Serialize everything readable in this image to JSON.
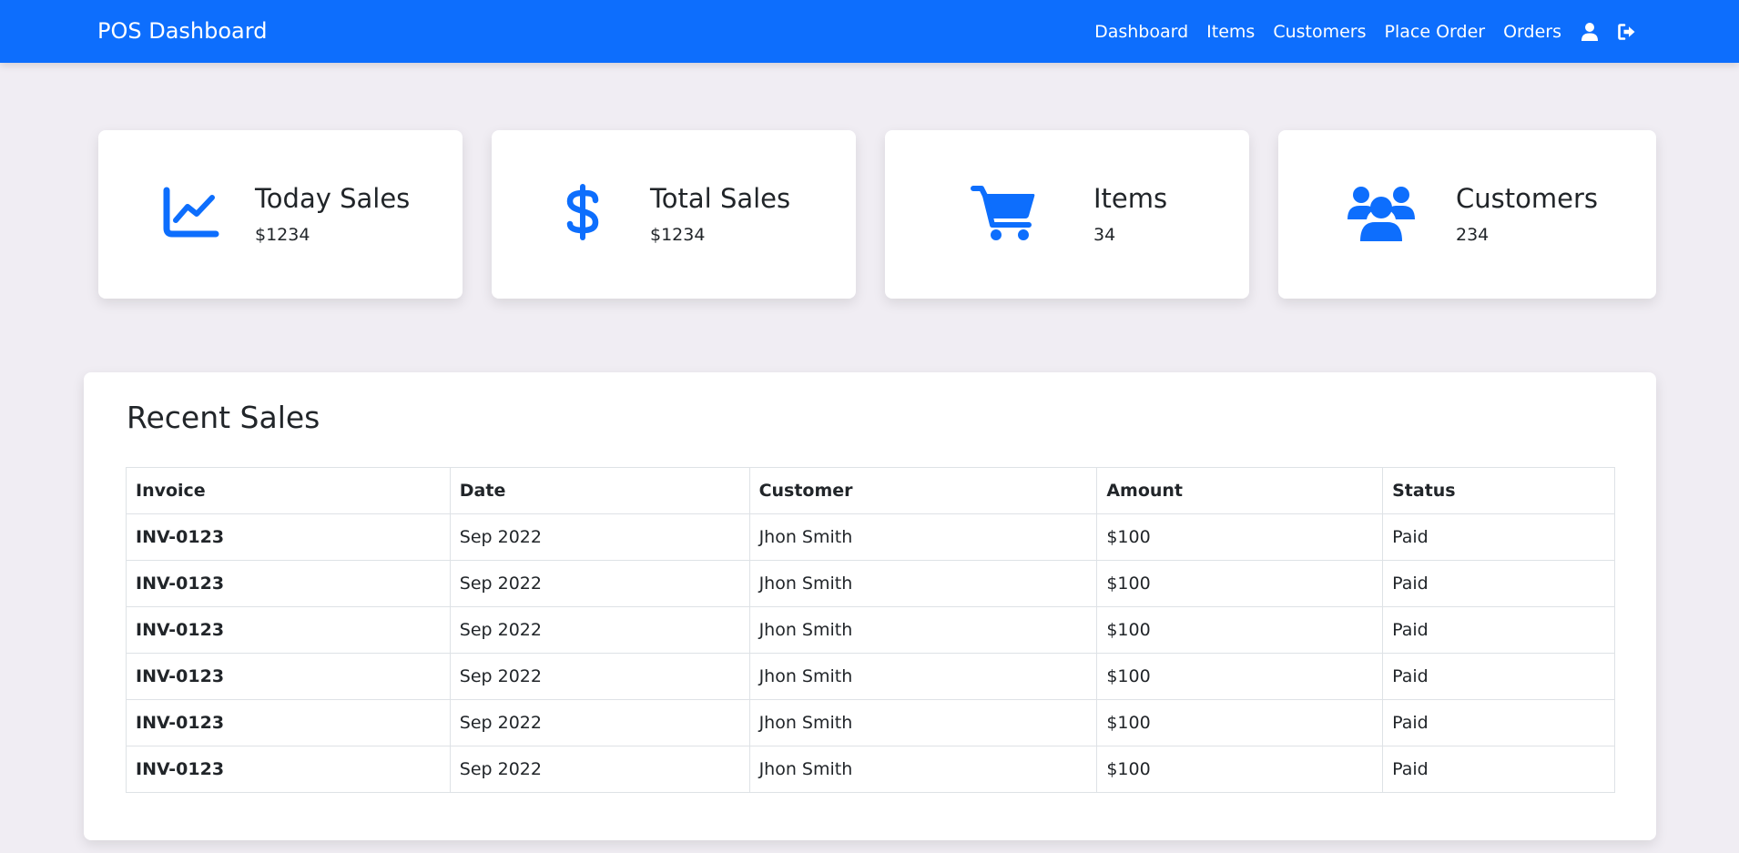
{
  "navbar": {
    "brand": "POS Dashboard",
    "links": [
      {
        "label": "Dashboard"
      },
      {
        "label": "Items"
      },
      {
        "label": "Customers"
      },
      {
        "label": "Place Order"
      },
      {
        "label": "Orders"
      }
    ],
    "icons": [
      "user-icon",
      "logout-icon"
    ]
  },
  "stats": [
    {
      "icon": "chart-line-icon",
      "title": "Today Sales",
      "value": "$1234"
    },
    {
      "icon": "dollar-icon",
      "title": "Total Sales",
      "value": "$1234"
    },
    {
      "icon": "cart-icon",
      "title": "Items",
      "value": "34"
    },
    {
      "icon": "users-icon",
      "title": "Customers",
      "value": "234"
    }
  ],
  "recent_sales": {
    "title": "Recent Sales",
    "columns": [
      "Invoice",
      "Date",
      "Customer",
      "Amount",
      "Status"
    ],
    "rows": [
      [
        "INV-0123",
        "Sep 2022",
        "Jhon Smith",
        "$100",
        "Paid"
      ],
      [
        "INV-0123",
        "Sep 2022",
        "Jhon Smith",
        "$100",
        "Paid"
      ],
      [
        "INV-0123",
        "Sep 2022",
        "Jhon Smith",
        "$100",
        "Paid"
      ],
      [
        "INV-0123",
        "Sep 2022",
        "Jhon Smith",
        "$100",
        "Paid"
      ],
      [
        "INV-0123",
        "Sep 2022",
        "Jhon Smith",
        "$100",
        "Paid"
      ],
      [
        "INV-0123",
        "Sep 2022",
        "Jhon Smith",
        "$100",
        "Paid"
      ]
    ]
  },
  "colors": {
    "primary": "#0d6efd",
    "background": "#f0edf3",
    "card": "#ffffff",
    "text": "#212529"
  }
}
